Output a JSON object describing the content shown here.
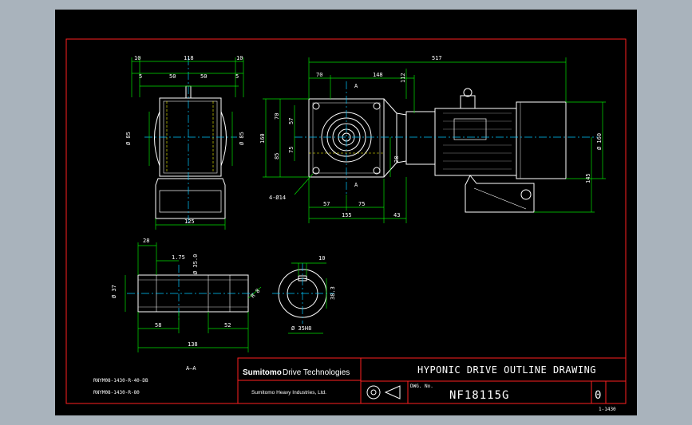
{
  "colors": {
    "background": "#000000",
    "frame": "#ff2020",
    "outline": "#ffffff",
    "dimension": "#00e000",
    "centerline": "#00c8ff",
    "hidden": "#ffff00",
    "workspace": "#a9b3bc"
  },
  "title_block": {
    "brand_main": "Sumitomo",
    "brand_rest": "Drive Technologies",
    "company": "Sumitomo Heavy Industries, Ltd.",
    "title": "HYPONIC DRIVE OUTLINE DRAWING",
    "drawing_number": "NF18115G",
    "revision": "0",
    "dwg_no_label": "DWG. No."
  },
  "corner_label": "1-1430",
  "section_label": "A—A",
  "model_lines": [
    "RNYM08-1430-R-40-DB",
    "RNYM08-1430-R-80"
  ],
  "side_view_dims": {
    "top_overall": "118",
    "top_left": "10",
    "top_right": "10",
    "mid_left": "50",
    "mid_right": "50",
    "edge_left": "5",
    "edge_right": "5",
    "dia_left": "Ø 85",
    "dia_right": "Ø 85",
    "bottom": "125"
  },
  "front_view_dims": {
    "overall": "517",
    "left_a": "70",
    "left_b": "148",
    "offset_top": "112",
    "section_mark_top": "A",
    "section_mark_bottom": "A",
    "h_total": "160",
    "h_70": "70",
    "h_57": "57",
    "h_85": "85",
    "h_75": "75",
    "h_28": "28",
    "hole": "4-Ø14",
    "bot_57": "57",
    "bot_75": "75",
    "bot_155": "155",
    "bot_43": "43",
    "motor_dia": "Ø 160",
    "motor_h": "145"
  },
  "shaft_dims": {
    "top_28": "28",
    "chamfer": "1.75",
    "shaft_dia": "Ø 35.0",
    "dia_37": "Ø 37",
    "r_8": "R 8",
    "len_58_left": "58",
    "len_52_right": "52",
    "len_138": "138",
    "key_10": "10",
    "key_38": "38.3",
    "bore_dia": "Ø 35H8"
  }
}
